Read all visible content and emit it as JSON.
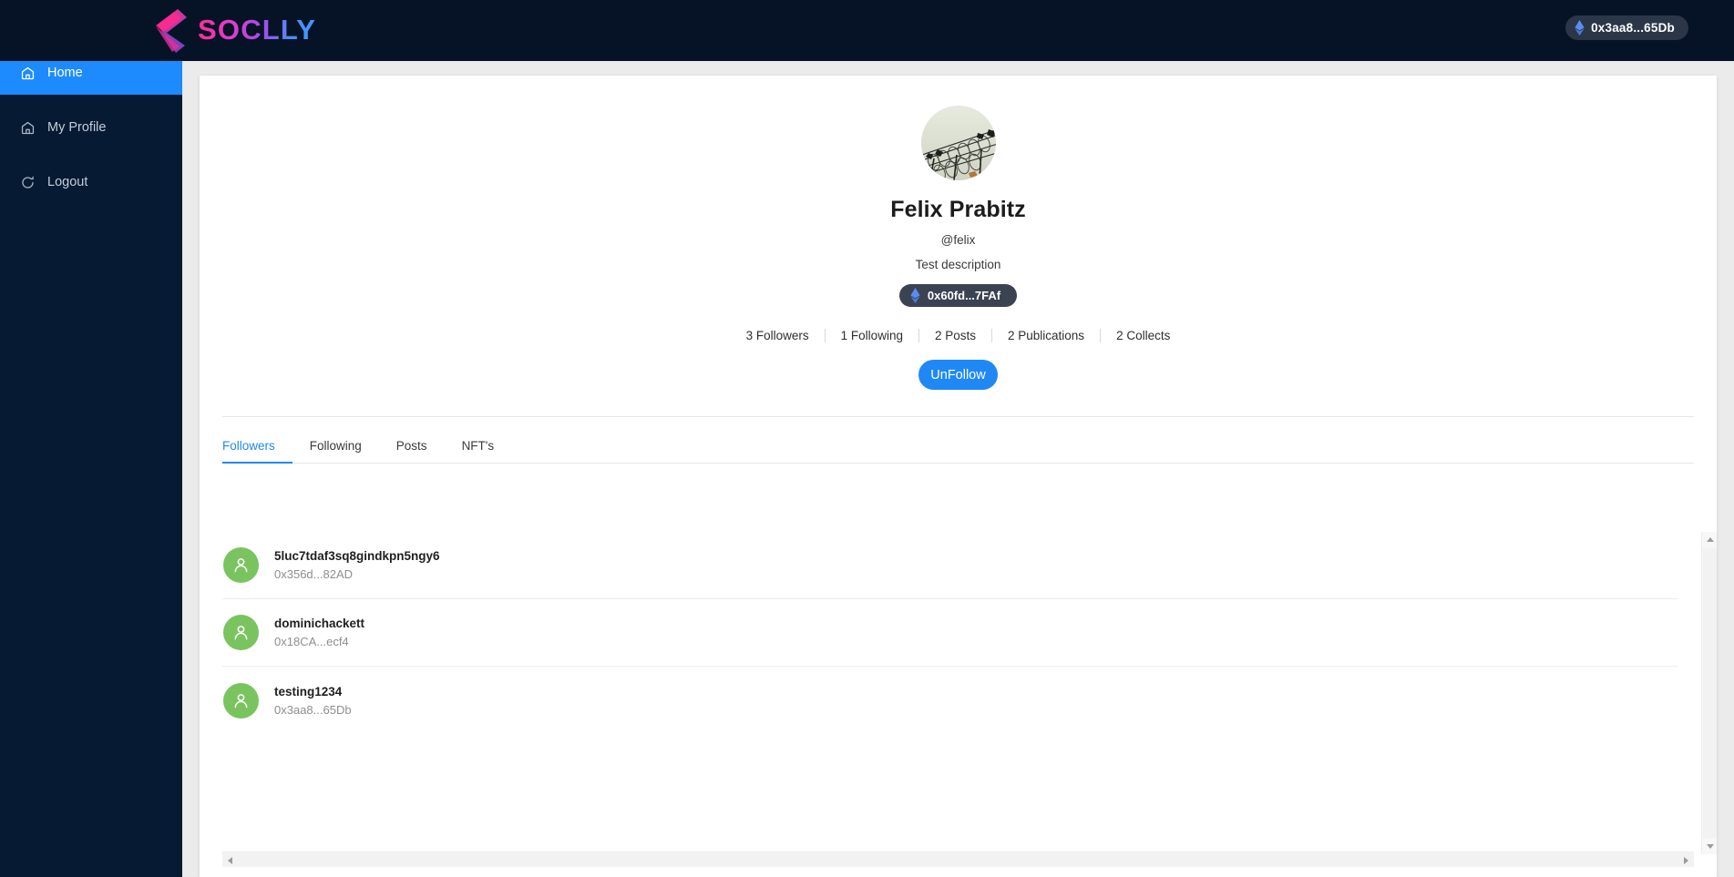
{
  "brand": {
    "name": "SOCLLY",
    "logo_icon": "soclly-s-logo",
    "gradient_start": "#ff2e93",
    "gradient_end": "#3d9bff"
  },
  "topbar": {
    "wallet": {
      "address": "0x3aa8...65Db",
      "icon": "ethereum-icon",
      "background": "#2b3648"
    }
  },
  "sidebar": {
    "background": "#061a33",
    "active_color": "#1d8bfd",
    "items": [
      {
        "label": "Home",
        "icon": "home-icon",
        "active": true
      },
      {
        "label": "My Profile",
        "icon": "home-icon",
        "active": false
      },
      {
        "label": "Logout",
        "icon": "logout-icon",
        "active": false
      }
    ]
  },
  "profile": {
    "avatar_icon": "barbed-wire-photo-avatar",
    "display_name": "Felix Prabitz",
    "handle": "@felix",
    "description": "Test description",
    "wallet": {
      "address": "0x60fd...7FAf",
      "icon": "ethereum-icon",
      "background": "#3b4352"
    },
    "stats": [
      {
        "label": "3 Followers"
      },
      {
        "label": "1 Following"
      },
      {
        "label": "2 Posts"
      },
      {
        "label": "2 Publications"
      },
      {
        "label": "2 Collects"
      }
    ],
    "follow_button": {
      "label": "UnFollow",
      "color": "#2088f5"
    }
  },
  "tabs": {
    "active_color": "#2088f5",
    "items": [
      {
        "label": "Followers",
        "active": true
      },
      {
        "label": "Following",
        "active": false
      },
      {
        "label": "Posts",
        "active": false
      },
      {
        "label": "NFT's",
        "active": false
      }
    ]
  },
  "followers_list": {
    "avatar_color": "#79c45e",
    "rows": [
      {
        "name": "5luc7tdaf3sq8gindkpn5ngy6",
        "address": "0x356d...82AD",
        "avatar_icon": "user-icon"
      },
      {
        "name": "dominichackett",
        "address": "0x18CA...ecf4",
        "avatar_icon": "user-icon"
      },
      {
        "name": "testing1234",
        "address": "0x3aa8...65Db",
        "avatar_icon": "user-icon"
      }
    ]
  },
  "scrollbars": {
    "vertical": {
      "up_icon": "triangle-up-icon",
      "down_icon": "triangle-down-icon"
    },
    "horizontal": {
      "left_icon": "triangle-left-icon",
      "right_icon": "triangle-right-icon"
    }
  }
}
